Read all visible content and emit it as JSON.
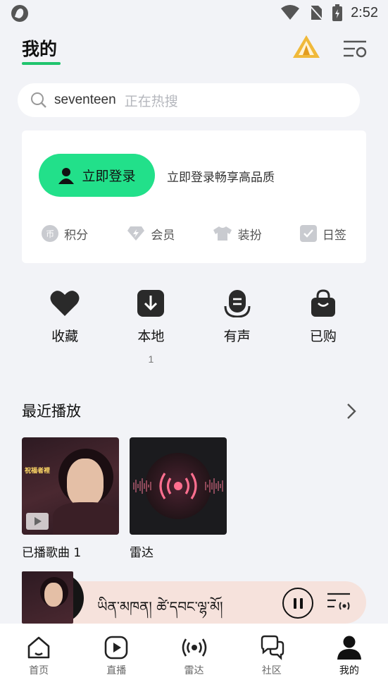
{
  "status_bar": {
    "time": "2:52"
  },
  "header": {
    "title": "我的"
  },
  "search": {
    "query": "seventeen",
    "hint": "正在热搜"
  },
  "login_card": {
    "button_label": "立即登录",
    "hint": "立即登录畅享高品质",
    "items": [
      {
        "icon": "coin-icon",
        "label": "积分"
      },
      {
        "icon": "diamond-icon",
        "label": "会员"
      },
      {
        "icon": "shirt-icon",
        "label": "装扮"
      },
      {
        "icon": "checkin-icon",
        "label": "日签"
      }
    ]
  },
  "quick_actions": [
    {
      "icon": "heart-icon",
      "label": "收藏",
      "count": ""
    },
    {
      "icon": "download-icon",
      "label": "本地",
      "count": "1"
    },
    {
      "icon": "audiobook-icon",
      "label": "有声",
      "count": ""
    },
    {
      "icon": "shopping-bag-icon",
      "label": "已购",
      "count": ""
    }
  ],
  "recent": {
    "title": "最近播放",
    "items": [
      {
        "label": "已播歌曲 1"
      },
      {
        "label": "雷达"
      }
    ]
  },
  "player": {
    "title": "ཡིན་མཁན། ཚེ་དབང་ལྷ་མོ།"
  },
  "bottom_nav": [
    {
      "icon": "home-icon",
      "label": "首页"
    },
    {
      "icon": "live-icon",
      "label": "直播"
    },
    {
      "icon": "radar-icon",
      "label": "雷达"
    },
    {
      "icon": "community-icon",
      "label": "社区"
    },
    {
      "icon": "profile-icon",
      "label": "我的",
      "active": true
    }
  ],
  "colors": {
    "accent": "#20c46e",
    "login_button": "#22e08a",
    "player_bg": "#f6e2dc",
    "background": "#f2f3f7"
  }
}
